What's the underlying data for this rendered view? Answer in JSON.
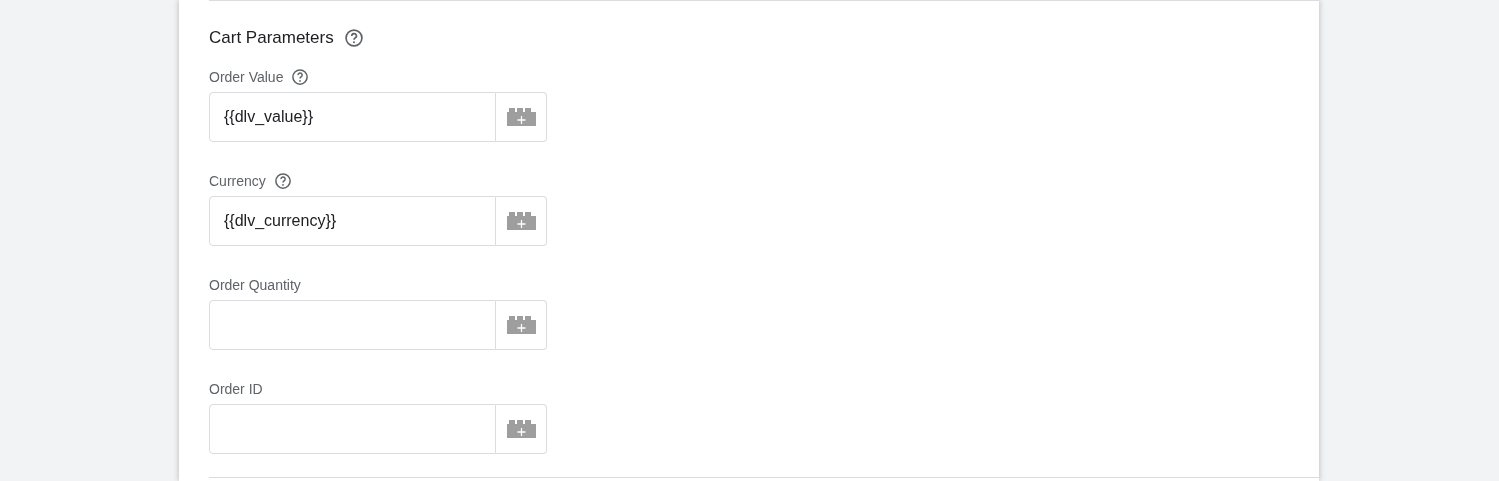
{
  "section": {
    "title": "Cart Parameters",
    "help": true
  },
  "fields": [
    {
      "label": "Order Value",
      "help": true,
      "value": "{{dlv_value}}"
    },
    {
      "label": "Currency",
      "help": true,
      "value": "{{dlv_currency}}"
    },
    {
      "label": "Order Quantity",
      "help": false
    },
    {
      "label": "Order ID",
      "help": false
    }
  ]
}
